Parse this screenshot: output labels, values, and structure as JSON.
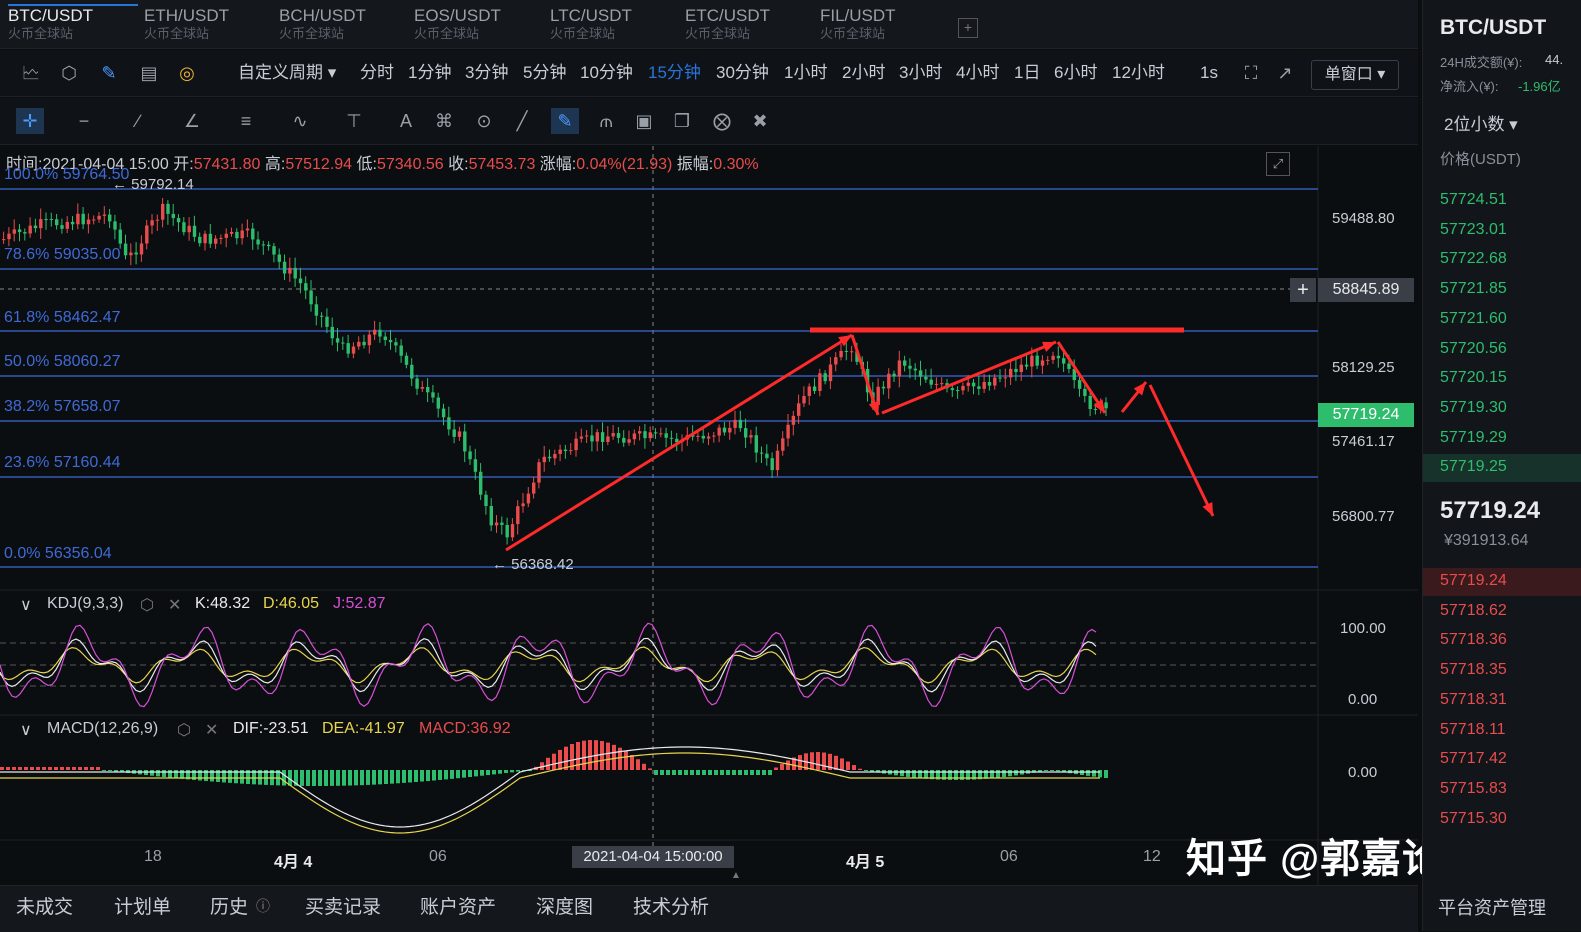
{
  "pair_tabs": [
    {
      "pair": "BTC/USDT",
      "sub": "火币全球站"
    },
    {
      "pair": "ETH/USDT",
      "sub": "火币全球站"
    },
    {
      "pair": "BCH/USDT",
      "sub": "火币全球站"
    },
    {
      "pair": "EOS/USDT",
      "sub": "火币全球站"
    },
    {
      "pair": "LTC/USDT",
      "sub": "火币全球站"
    },
    {
      "pair": "ETC/USDT",
      "sub": "火币全球站"
    },
    {
      "pair": "FIL/USDT",
      "sub": "火币全球站"
    }
  ],
  "add_tab": "+",
  "toolbar": {
    "custom_period": "自定义周期 ▾",
    "periods": [
      "分时",
      "1分钟",
      "3分钟",
      "5分钟",
      "10分钟",
      "15分钟",
      "30分钟",
      "1小时",
      "2小时",
      "3小时",
      "4小时",
      "1日",
      "6小时",
      "12小时"
    ],
    "interval": "1s",
    "single_window": "单窗口 ▾"
  },
  "ohlc": {
    "time_label": "时间:",
    "time": "2021-04-04 15:00",
    "open_label": "开:",
    "open": "57431.80",
    "high_label": "高:",
    "high": "57512.94",
    "low_label": "低:",
    "low": "57340.56",
    "close_label": "收:",
    "close": "57453.73",
    "change_label": "涨幅:",
    "change": "0.04%(21.93)",
    "amp_label": "振幅:",
    "amp": "0.30%"
  },
  "fib": [
    {
      "label": "100.0% 59764.50"
    },
    {
      "label": "78.6% 59035.00"
    },
    {
      "label": "61.8% 58462.47"
    },
    {
      "label": "50.0% 58060.27"
    },
    {
      "label": "38.2% 57658.07"
    },
    {
      "label": "23.6% 57160.44"
    },
    {
      "label": "0.0% 56356.04"
    }
  ],
  "high_marker": "← 59792.14",
  "low_marker": "← 56368.42",
  "y_axis": [
    "59488.80",
    "58129.25",
    "57461.17",
    "56800.77"
  ],
  "cross_price": "58845.89",
  "current_price_tag": "57719.24",
  "kdj": {
    "name": "KDJ(9,3,3)",
    "k": "K:48.32",
    "d": "D:46.05",
    "j": "J:52.87",
    "y_top": "100.00",
    "y_bot": "0.00"
  },
  "macd": {
    "name": "MACD(12,26,9)",
    "dif": "DIF:-23.51",
    "dea": "DEA:-41.97",
    "macd": "MACD:36.92",
    "y_mid": "0.00"
  },
  "x_axis": [
    "18",
    "4月 4",
    "06",
    "4月 5",
    "06",
    "12"
  ],
  "crosshair_date": "2021-04-04 15:00:00",
  "bottom_tabs": [
    "未成交",
    "计划单",
    "历史",
    "买卖记录",
    "账户资产",
    "深度图",
    "技术分析"
  ],
  "watermark": "知乎 @郭嘉论币",
  "right": {
    "title": "BTC/USDT",
    "vol_label": "24H成交额(¥):",
    "vol_value": "44.",
    "inflow_label": "净流入(¥):",
    "inflow_value": "-1.96亿",
    "decimals": "2位小数 ▾",
    "price_header": "价格(USDT)",
    "asks": [
      "57724.51",
      "57723.01",
      "57722.68",
      "57721.85",
      "57721.60",
      "57720.56",
      "57720.15",
      "57719.30",
      "57719.29",
      "57719.25"
    ],
    "last_price": "57719.24",
    "last_cny": "¥391913.64",
    "bids": [
      "57719.24",
      "57718.62",
      "57718.36",
      "57718.35",
      "57718.31",
      "57718.11",
      "57717.42",
      "57715.83",
      "57715.30"
    ],
    "asset_mgmt": "平台资产管理"
  },
  "colors": {
    "up": "#e84c4c",
    "down": "#2ebd6c",
    "fib": "#3f6ad6",
    "arrow": "#ff2a2a"
  }
}
